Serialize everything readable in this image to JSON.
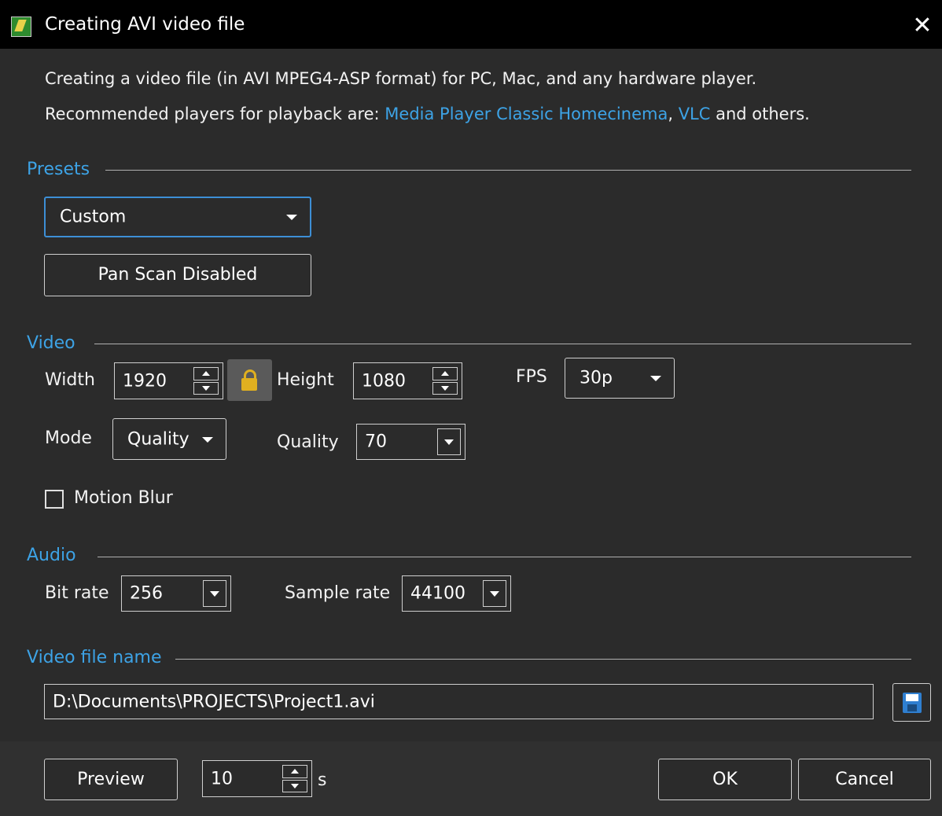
{
  "window": {
    "title": "Creating AVI video file",
    "close_glyph": "✕"
  },
  "description": {
    "line1": "Creating a video file (in AVI MPEG4-ASP format) for PC, Mac, and any hardware player.",
    "line2_prefix": "Recommended players for playback are: ",
    "link1": "Media Player Classic Homecinema",
    "separator": ", ",
    "link2": "VLC",
    "line2_suffix": " and others."
  },
  "presets": {
    "section_label": "Presets",
    "selected": "Custom",
    "pan_scan_button": "Pan  Scan Disabled"
  },
  "video": {
    "section_label": "Video",
    "width_label": "Width",
    "width_value": "1920",
    "height_label": "Height",
    "height_value": "1080",
    "fps_label": "FPS",
    "fps_value": "30p",
    "mode_label": "Mode",
    "mode_value": "Quality",
    "quality_label": "Quality",
    "quality_value": "70",
    "motion_blur_label": "Motion Blur",
    "motion_blur_checked": false
  },
  "audio": {
    "section_label": "Audio",
    "bitrate_label": "Bit rate",
    "bitrate_value": "256",
    "samplerate_label": "Sample rate",
    "samplerate_value": "44100"
  },
  "file": {
    "section_label": "Video file name",
    "path": "D:\\Documents\\PROJECTS\\Project1.avi"
  },
  "footer": {
    "preview_button": "Preview",
    "preview_seconds": "10",
    "seconds_unit": "s",
    "ok_button": "OK",
    "cancel_button": "Cancel"
  },
  "colors": {
    "background": "#2b2b2b",
    "titlebar": "#000000",
    "accent": "#3da3e6",
    "focus_border": "#3d8fd6"
  },
  "icons": {
    "app": "app-icon",
    "close": "close-icon",
    "lock": "lock-icon",
    "save": "floppy-disk-icon"
  }
}
